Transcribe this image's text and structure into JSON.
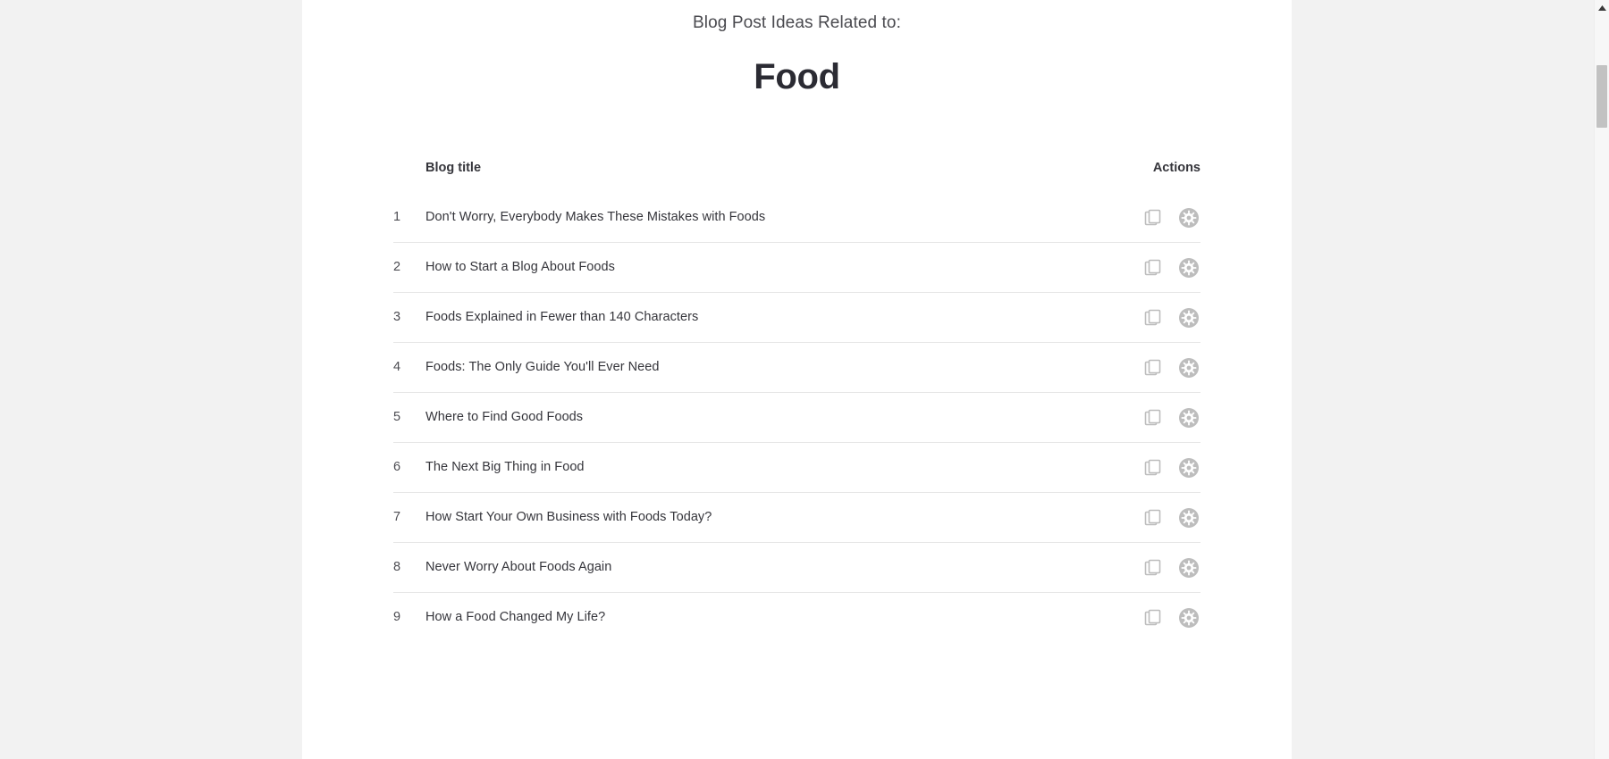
{
  "header": {
    "subtitle": "Blog Post Ideas Related to:",
    "topic": "Food"
  },
  "table": {
    "columns": {
      "index": "",
      "title": "Blog title",
      "actions": "Actions"
    },
    "rows": [
      {
        "index": "1",
        "title": "Don't Worry, Everybody Makes These Mistakes with Foods"
      },
      {
        "index": "2",
        "title": "How to Start a Blog About Foods"
      },
      {
        "index": "3",
        "title": "Foods Explained in Fewer than 140 Characters"
      },
      {
        "index": "4",
        "title": "Foods: The Only Guide You'll Ever Need"
      },
      {
        "index": "5",
        "title": "Where to Find Good Foods"
      },
      {
        "index": "6",
        "title": "The Next Big Thing in Food"
      },
      {
        "index": "7",
        "title": "How Start Your Own Business with Foods Today?"
      },
      {
        "index": "8",
        "title": "Never Worry About Foods Again"
      },
      {
        "index": "9",
        "title": "How a Food Changed My Life?"
      }
    ],
    "row_actions": [
      {
        "icon": "copy-icon"
      },
      {
        "icon": "gear-icon"
      }
    ]
  },
  "scrollbar": {
    "up_arrow_icon": "scroll-up-arrow-icon",
    "thumb_icon": "scrollbar-thumb"
  },
  "colors": {
    "page_background": "#f2f2f2",
    "card_background": "#ffffff",
    "title_text": "#2b2b33",
    "subtitle_text": "#4a4a4f",
    "body_text": "#35353b",
    "divider": "#e6e6e6",
    "icon_gray": "#bdbdbd",
    "scrollbar_thumb": "#c2c2c2"
  }
}
